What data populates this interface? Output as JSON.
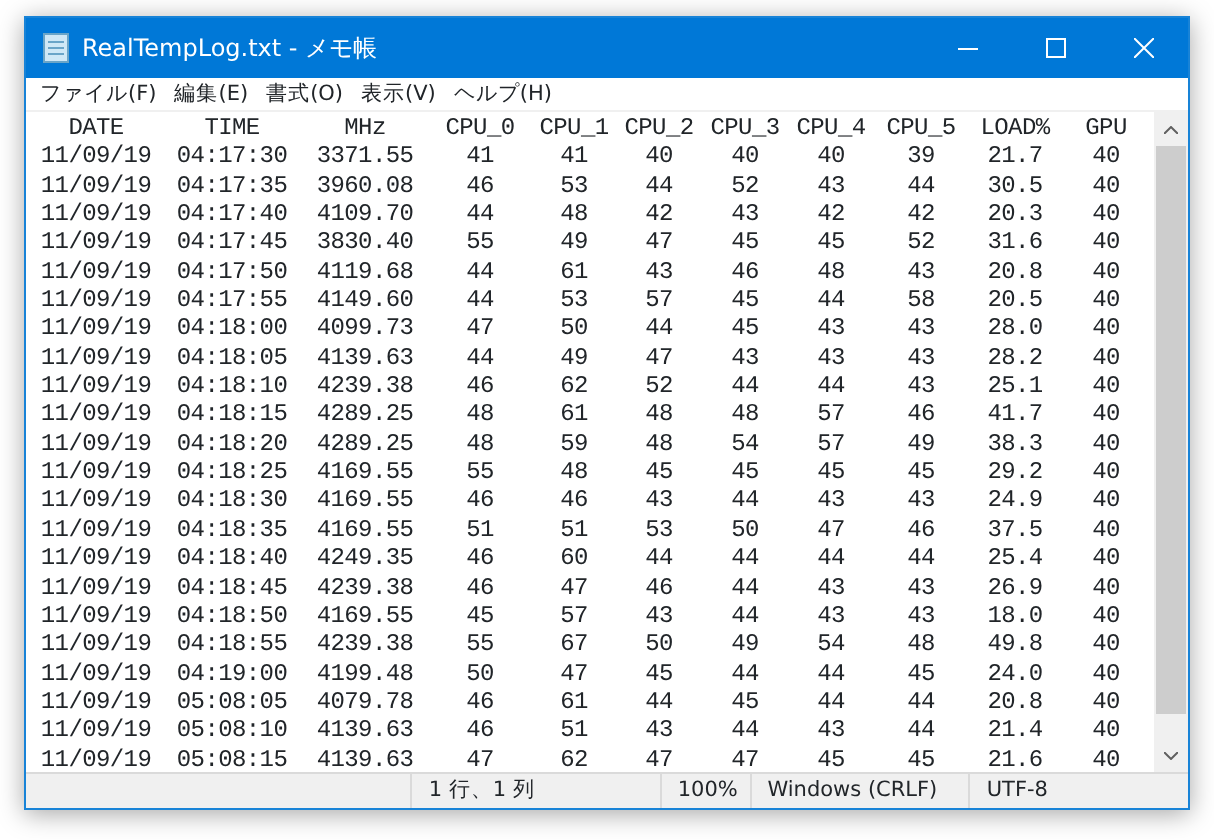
{
  "window": {
    "title": "RealTempLog.txt - メモ帳"
  },
  "menu": [
    "ファイル(F)",
    "編集(E)",
    "書式(O)",
    "表示(V)",
    "ヘルプ(H)"
  ],
  "text": {
    "columns": [
      "DATE",
      "TIME",
      "MHz",
      "CPU_0",
      "CPU_1",
      "CPU_2",
      "CPU_3",
      "CPU_4",
      "CPU_5",
      "LOAD%",
      "GPU"
    ],
    "rows": [
      [
        "11/09/19",
        "04:17:30",
        "3371.55",
        "41",
        "41",
        "40",
        "40",
        "40",
        "39",
        "21.7",
        "40"
      ],
      [
        "11/09/19",
        "04:17:35",
        "3960.08",
        "46",
        "53",
        "44",
        "52",
        "43",
        "44",
        "30.5",
        "40"
      ],
      [
        "11/09/19",
        "04:17:40",
        "4109.70",
        "44",
        "48",
        "42",
        "43",
        "42",
        "42",
        "20.3",
        "40"
      ],
      [
        "11/09/19",
        "04:17:45",
        "3830.40",
        "55",
        "49",
        "47",
        "45",
        "45",
        "52",
        "31.6",
        "40"
      ],
      [
        "11/09/19",
        "04:17:50",
        "4119.68",
        "44",
        "61",
        "43",
        "46",
        "48",
        "43",
        "20.8",
        "40"
      ],
      [
        "11/09/19",
        "04:17:55",
        "4149.60",
        "44",
        "53",
        "57",
        "45",
        "44",
        "58",
        "20.5",
        "40"
      ],
      [
        "11/09/19",
        "04:18:00",
        "4099.73",
        "47",
        "50",
        "44",
        "45",
        "43",
        "43",
        "28.0",
        "40"
      ],
      [
        "11/09/19",
        "04:18:05",
        "4139.63",
        "44",
        "49",
        "47",
        "43",
        "43",
        "43",
        "28.2",
        "40"
      ],
      [
        "11/09/19",
        "04:18:10",
        "4239.38",
        "46",
        "62",
        "52",
        "44",
        "44",
        "43",
        "25.1",
        "40"
      ],
      [
        "11/09/19",
        "04:18:15",
        "4289.25",
        "48",
        "61",
        "48",
        "48",
        "57",
        "46",
        "41.7",
        "40"
      ],
      [
        "11/09/19",
        "04:18:20",
        "4289.25",
        "48",
        "59",
        "48",
        "54",
        "57",
        "49",
        "38.3",
        "40"
      ],
      [
        "11/09/19",
        "04:18:25",
        "4169.55",
        "55",
        "48",
        "45",
        "45",
        "45",
        "45",
        "29.2",
        "40"
      ],
      [
        "11/09/19",
        "04:18:30",
        "4169.55",
        "46",
        "46",
        "43",
        "44",
        "43",
        "43",
        "24.9",
        "40"
      ],
      [
        "11/09/19",
        "04:18:35",
        "4169.55",
        "51",
        "51",
        "53",
        "50",
        "47",
        "46",
        "37.5",
        "40"
      ],
      [
        "11/09/19",
        "04:18:40",
        "4249.35",
        "46",
        "60",
        "44",
        "44",
        "44",
        "44",
        "25.4",
        "40"
      ],
      [
        "11/09/19",
        "04:18:45",
        "4239.38",
        "46",
        "47",
        "46",
        "44",
        "43",
        "43",
        "26.9",
        "40"
      ],
      [
        "11/09/19",
        "04:18:50",
        "4169.55",
        "45",
        "57",
        "43",
        "44",
        "43",
        "43",
        "18.0",
        "40"
      ],
      [
        "11/09/19",
        "04:18:55",
        "4239.38",
        "55",
        "67",
        "50",
        "49",
        "54",
        "48",
        "49.8",
        "40"
      ],
      [
        "11/09/19",
        "04:19:00",
        "4199.48",
        "50",
        "47",
        "45",
        "44",
        "44",
        "45",
        "24.0",
        "40"
      ],
      [
        "11/09/19",
        "05:08:05",
        "4079.78",
        "46",
        "61",
        "44",
        "45",
        "44",
        "44",
        "20.8",
        "40"
      ],
      [
        "11/09/19",
        "05:08:10",
        "4139.63",
        "46",
        "51",
        "43",
        "44",
        "43",
        "44",
        "21.4",
        "40"
      ],
      [
        "11/09/19",
        "05:08:15",
        "4139.63",
        "47",
        "62",
        "47",
        "47",
        "45",
        "45",
        "21.6",
        "40"
      ]
    ]
  },
  "status_bar": [
    "1 行、1 列",
    "100%",
    "Windows (CRLF)",
    "UTF-8"
  ]
}
